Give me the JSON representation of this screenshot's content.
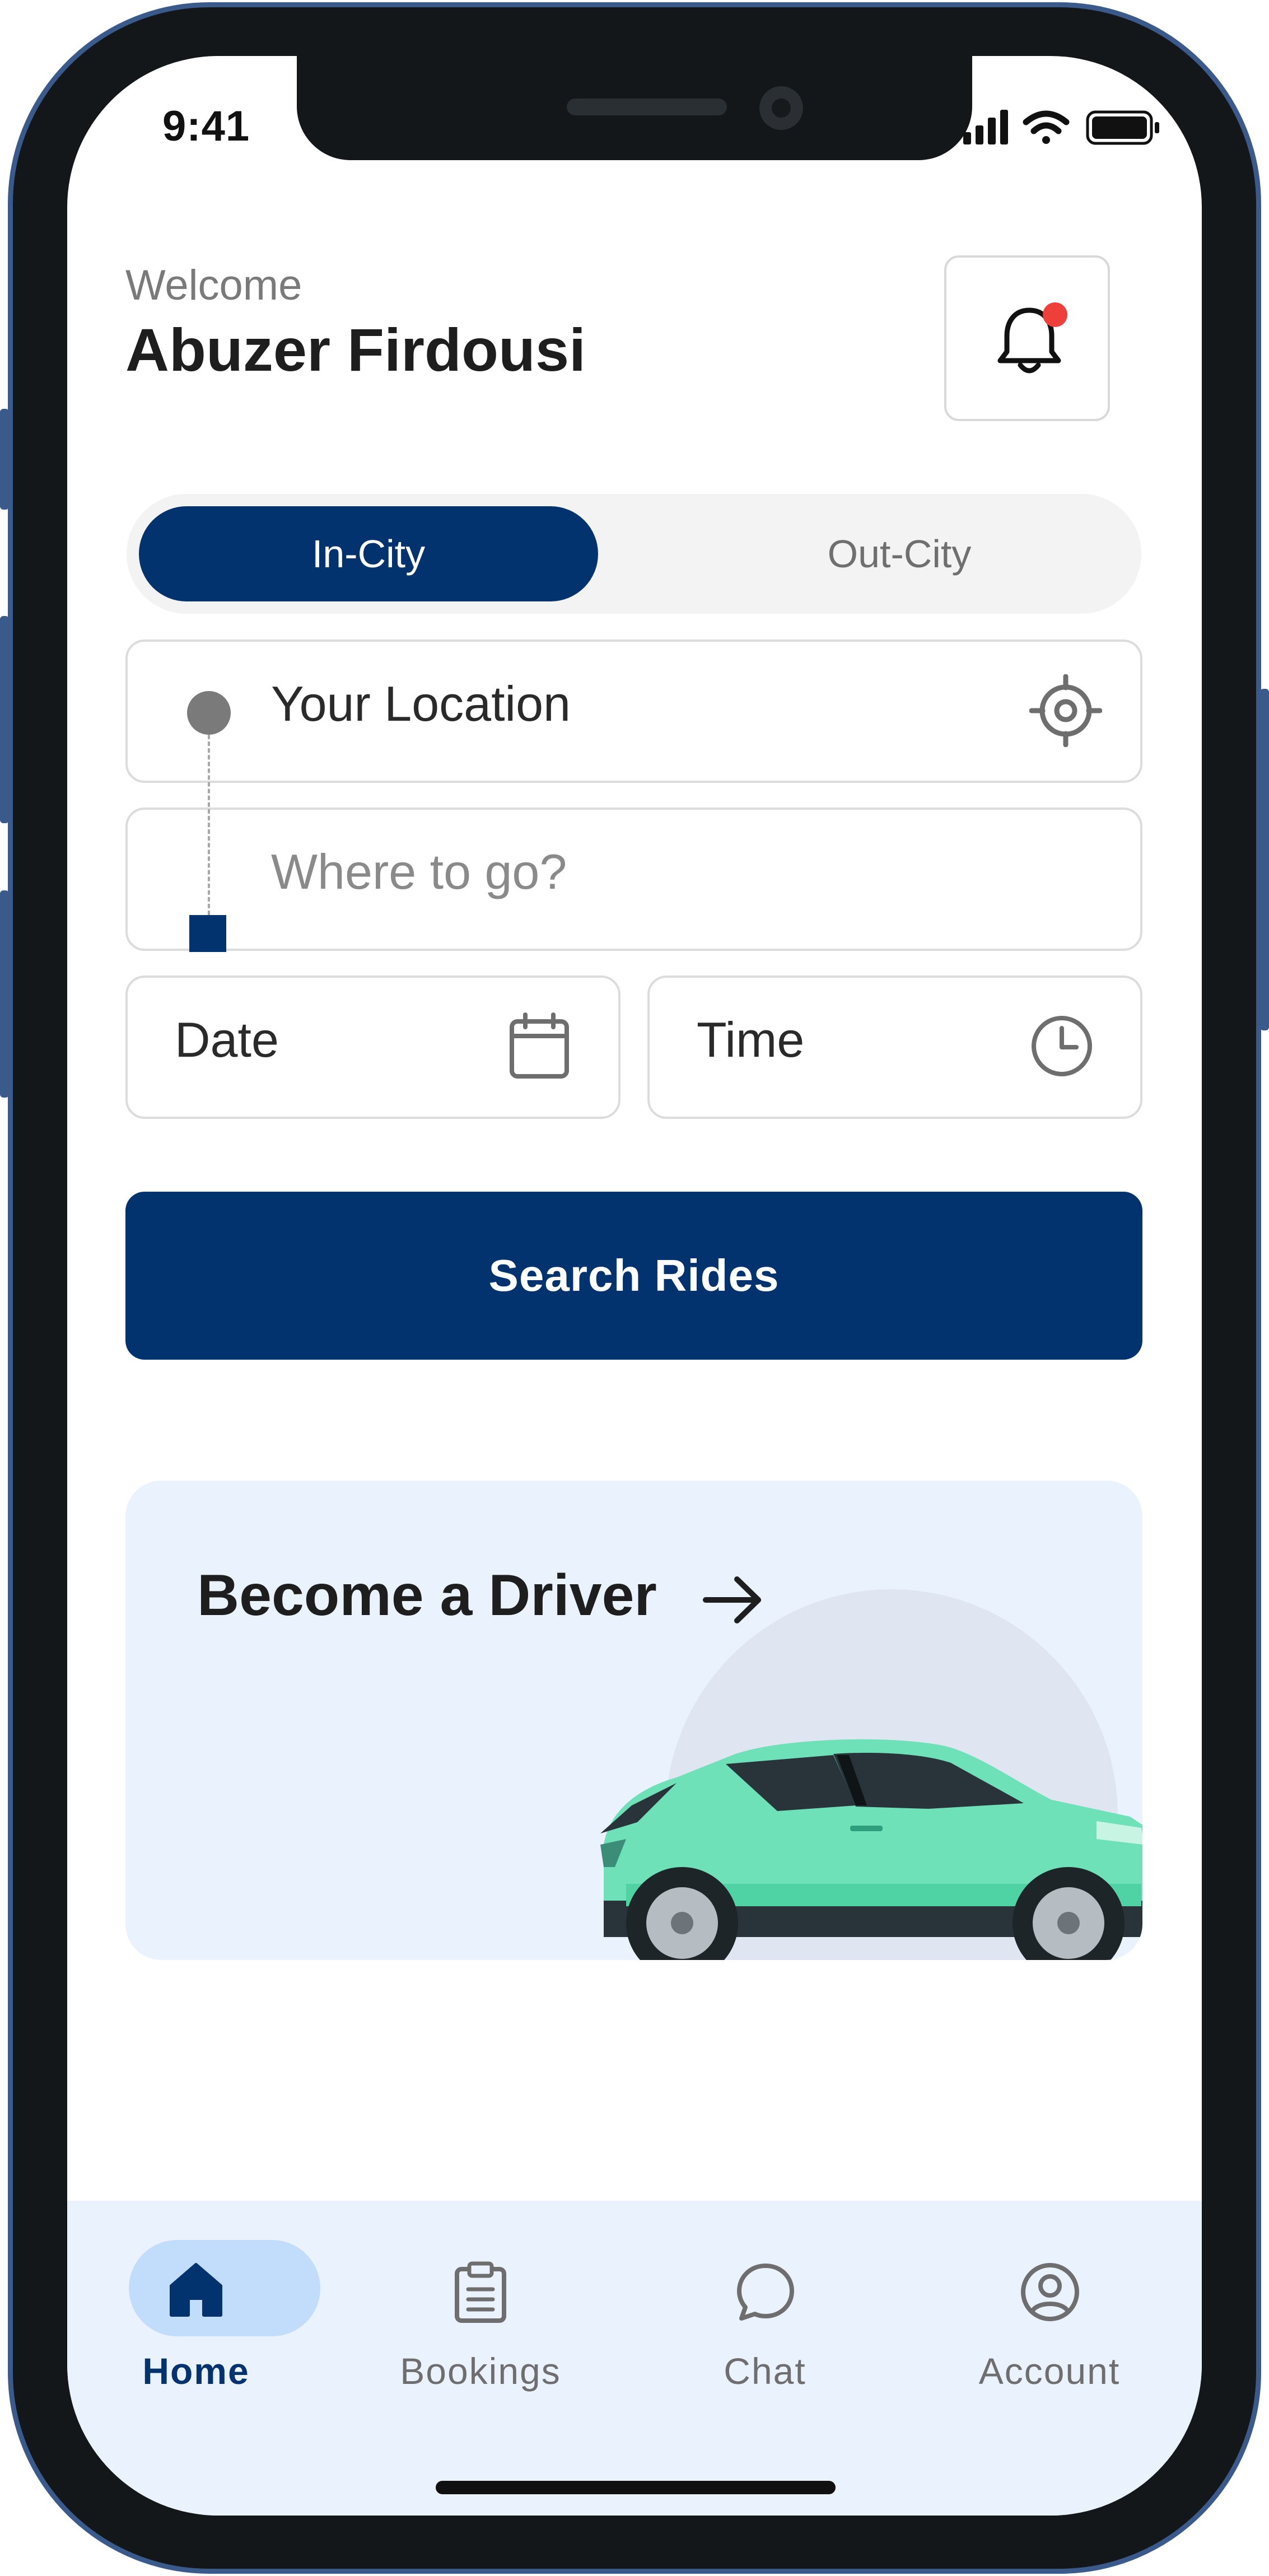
{
  "status_bar": {
    "time": "9:41",
    "icons": [
      "signal-icon",
      "wifi-icon",
      "battery-icon"
    ]
  },
  "header": {
    "welcome": "Welcome",
    "user_name": "Abuzer Firdousi",
    "notification_icon": "bell-icon",
    "has_unread": true
  },
  "trip_type": {
    "options": [
      "In-City",
      "Out-City"
    ],
    "selected": "In-City"
  },
  "form": {
    "pickup": {
      "value": "Your Location",
      "icon": "locate-icon"
    },
    "destination": {
      "placeholder": "Where to go?"
    },
    "date": {
      "label": "Date",
      "icon": "calendar-icon"
    },
    "time": {
      "label": "Time",
      "icon": "clock-icon"
    },
    "search_label": "Search Rides"
  },
  "promo": {
    "title": "Become a Driver",
    "arrow": "arrow-right-icon",
    "image": "car-illustration"
  },
  "bottom_nav": {
    "items": [
      {
        "label": "Home",
        "icon": "home-icon",
        "active": true
      },
      {
        "label": "Bookings",
        "icon": "clipboard-icon",
        "active": false
      },
      {
        "label": "Chat",
        "icon": "chat-icon",
        "active": false
      },
      {
        "label": "Account",
        "icon": "account-icon",
        "active": false
      }
    ]
  },
  "colors": {
    "primary": "#02336e",
    "accent_light": "#eaf3fd",
    "pill": "#c2ddfb",
    "badge": "#ef3f3a",
    "car": "#6fe1b8"
  }
}
